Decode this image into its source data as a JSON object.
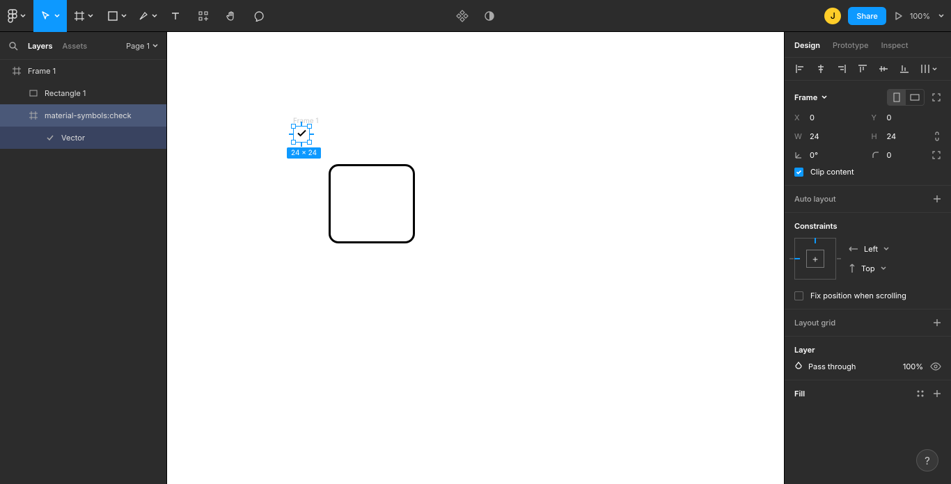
{
  "toolbar": {
    "share_label": "Share",
    "zoom_label": "100%",
    "avatar_letter": "J"
  },
  "left_panel": {
    "layers_tab": "Layers",
    "assets_tab": "Assets",
    "page_label": "Page 1",
    "layers": {
      "frame": "Frame 1",
      "rectangle": "Rectangle 1",
      "icon_frame": "material-symbols:check",
      "vector": "Vector"
    }
  },
  "canvas": {
    "frame_label": "Frame 1",
    "selection_dims": "24 × 24"
  },
  "right_panel": {
    "tabs": {
      "design": "Design",
      "prototype": "Prototype",
      "inspect": "Inspect"
    },
    "frame_section_title": "Frame",
    "props": {
      "x_label": "X",
      "x_val": "0",
      "y_label": "Y",
      "y_val": "0",
      "w_label": "W",
      "w_val": "24",
      "h_label": "H",
      "h_val": "24",
      "rot_val": "0°",
      "rad_val": "0"
    },
    "clip_content": "Clip content",
    "auto_layout": "Auto layout",
    "constraints_title": "Constraints",
    "constraint_h": "Left",
    "constraint_v": "Top",
    "fix_position": "Fix position when scrolling",
    "layout_grid": "Layout grid",
    "layer_title": "Layer",
    "pass_through": "Pass through",
    "layer_opacity": "100%",
    "fill_title": "Fill"
  }
}
